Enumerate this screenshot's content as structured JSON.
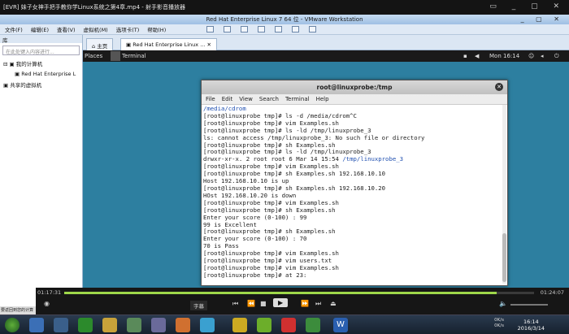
{
  "player_title": "[EVR] 妹子女神手把手教你学Linux系统之第4章.mp4 - 射手影音播放器",
  "vmware": {
    "title": "Red Hat Enterprise Linux 7 64 位 - VMware Workstation",
    "menu": [
      "文件(F)",
      "编辑(E)",
      "查看(V)",
      "虚拟机(M)",
      "选项卡(T)",
      "帮助(H)"
    ]
  },
  "library": {
    "title": "库",
    "search_placeholder": "在此处键入内容进行...",
    "tree": [
      "我的计算机",
      "Red Hat Enterprise L",
      "共享的虚拟机"
    ]
  },
  "tabs": [
    "主页",
    "Red Hat Enterprise Linux ..."
  ],
  "guest": {
    "places": "Places",
    "terminal_menu": "Terminal",
    "clock": "Mon 16:14"
  },
  "terminal": {
    "title": "root@linuxprobe:/tmp",
    "menu": [
      "File",
      "Edit",
      "View",
      "Search",
      "Terminal",
      "Help"
    ],
    "lines": [
      "/media/cdrom",
      "[root@linuxprobe tmp]# ls -d /media/cdrom^C",
      "[root@linuxprobe tmp]# vim Examples.sh",
      "[root@linuxprobe tmp]# ls -ld /tmp/linuxprobe_3",
      "ls: cannot access /tmp/linuxprobe_3: No such file or directory",
      "[root@linuxprobe tmp]# sh Examples.sh",
      "[root@linuxprobe tmp]# ls -ld /tmp/linuxprobe_3",
      "drwxr-xr-x. 2 root root 6 Mar 14 15:54 /tmp/linuxprobe_3",
      "[root@linuxprobe tmp]# vim Examples.sh",
      "[root@linuxprobe tmp]# sh Examples.sh 192.168.10.10",
      "Host 192.168.10.10 is up",
      "[root@linuxprobe tmp]# sh Examples.sh 192.168.10.20",
      "HOst 192.168.10.20 is down",
      "[root@linuxprobe tmp]# vim Examples.sh",
      "[root@linuxprobe tmp]# sh Examples.sh",
      "Enter your score (0-100) : 99",
      "99 is Excellent",
      "[root@linuxprobe tmp]# sh Examples.sh",
      "Enter your score (0-100) : 70",
      "70 is Pass",
      "[root@linuxprobe tmp]# vim Examples.sh",
      "[root@linuxprobe tmp]# vim users.txt",
      "[root@linuxprobe tmp]# vim Examples.sh",
      "[root@linuxprobe tmp]# at 23:"
    ]
  },
  "playback": {
    "elapsed": "01:17:31",
    "total": "01:24:07",
    "progress": 0.921,
    "subtitle_button": "字幕"
  },
  "status_text": "要返回到您的计算",
  "taskbar": {
    "time": "16:14",
    "date": "2016/3/14",
    "net_up": "0K/s",
    "net_down": "0K/s"
  }
}
